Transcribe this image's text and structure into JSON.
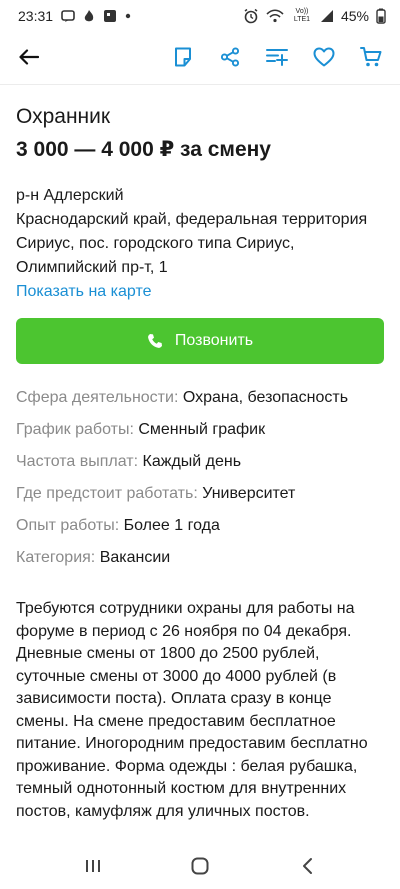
{
  "status_bar": {
    "time": "23:31",
    "battery": "45%",
    "network": "Vo)) LTE1"
  },
  "app_bar": {
    "icons": [
      "back-arrow-icon",
      "note-icon",
      "share-icon",
      "filter-list-icon",
      "heart-icon",
      "cart-icon"
    ]
  },
  "listing": {
    "title": "Охранник",
    "price": "3 000 — 4 000 ₽ за смену",
    "district": "р-н Адлерский",
    "address": "Краснодарский край, федеральная территория Сириус, пос. городского типа Сириус, Олимпийский пр-т, 1",
    "map_link": "Показать на карте",
    "call_button": "Позвонить"
  },
  "params": [
    {
      "label": "Сфера деятельности:",
      "value": "Охрана, безопасность"
    },
    {
      "label": "График работы:",
      "value": "Сменный график"
    },
    {
      "label": "Частота выплат:",
      "value": "Каждый день"
    },
    {
      "label": "Где предстоит работать:",
      "value": "Университет"
    },
    {
      "label": "Опыт работы:",
      "value": "Более 1 года"
    },
    {
      "label": "Категория:",
      "value": "Вакансии"
    }
  ],
  "description": "Требуются сотрудники охраны для работы на форуме в период с 26 ноября по 04 декабря. Дневные смены от 1800 до 2500 рублей, суточные смены от 3000 до 4000 рублей (в зависимости поста). Оплата сразу в конце смены. На смене предоставим бесплатное питание. Иногородним предоставим бесплатно проживание. Форма одежды : белая рубашка, темный однотонный костюм для внутренних постов, камуфляж для уличных постов."
}
